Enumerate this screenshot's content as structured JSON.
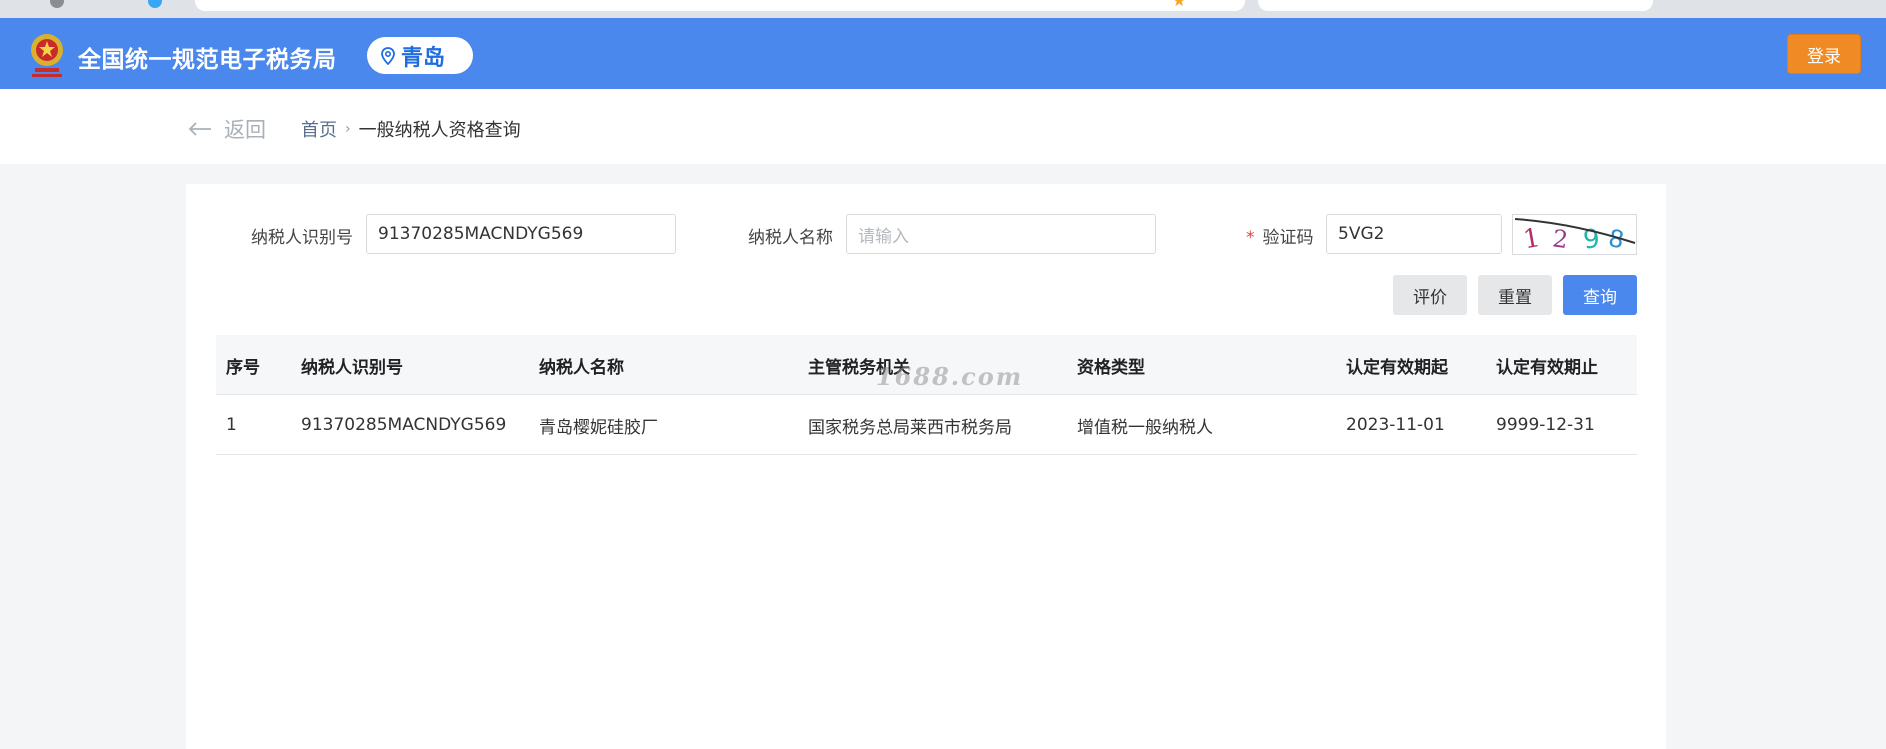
{
  "header": {
    "site_title": "全国统一规范电子税务局",
    "city": "青岛",
    "login_label": "登录",
    "icons": {
      "logo": "tax-emblem-icon",
      "location": "location-pin-icon"
    }
  },
  "breadcrumb": {
    "back_label": "返回",
    "home": "首页",
    "current": "一般纳税人资格查询"
  },
  "form": {
    "taxpayer_id_label": "纳税人识别号",
    "taxpayer_id_value": "91370285MACNDYG569",
    "taxpayer_name_label": "纳税人名称",
    "taxpayer_name_placeholder": "请输入",
    "captcha_label": "验证码",
    "captcha_required_mark": "*",
    "captcha_value": "5VG2",
    "captcha_image_text": "1298"
  },
  "actions": {
    "evaluate": "评价",
    "reset": "重置",
    "query": "查询"
  },
  "table": {
    "headers": [
      "序号",
      "纳税人识别号",
      "纳税人名称",
      "主管税务机关",
      "资格类型",
      "认定有效期起",
      "认定有效期止"
    ],
    "rows": [
      [
        "1",
        "91370285MACNDYG569",
        "青岛樱妮硅胶厂",
        "国家税务总局莱西市税务局",
        "增值税一般纳税人",
        "2023-11-01",
        "9999-12-31"
      ]
    ]
  },
  "watermark": "1688.com",
  "colors": {
    "header_bg": "#4a88ee",
    "login_bg": "#f08a24",
    "primary_button": "#4a88ee"
  }
}
